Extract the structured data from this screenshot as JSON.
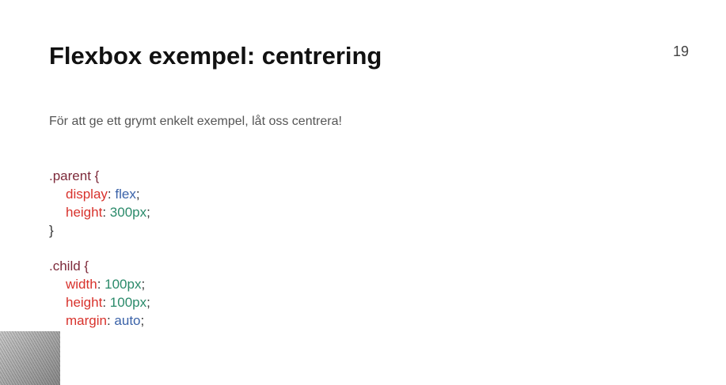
{
  "slide": {
    "title": "Flexbox exempel: centrering",
    "page_number": "19",
    "subtitle": "För att ge ett grymt enkelt exempel, låt oss centrera!"
  },
  "code": {
    "parent": {
      "selector": ".parent {",
      "decls": [
        {
          "prop": "display",
          "value": "flex",
          "value_type": "keyword"
        },
        {
          "prop": "height",
          "value": "300px",
          "value_type": "number"
        }
      ],
      "close": "}"
    },
    "child": {
      "selector": ".child {",
      "decls": [
        {
          "prop": "width",
          "value": "100px",
          "value_type": "number"
        },
        {
          "prop": "height",
          "value": "100px",
          "value_type": "number"
        },
        {
          "prop": "margin",
          "value": "auto",
          "value_type": "keyword"
        }
      ],
      "close": "}"
    },
    "colors": {
      "selector": "#7d2a3a",
      "property": "#d8322c",
      "number": "#2a8a6a",
      "keyword": "#3a62a8"
    }
  }
}
